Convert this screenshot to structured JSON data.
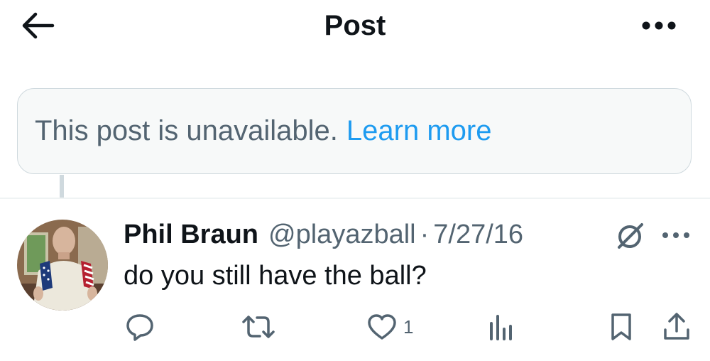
{
  "header": {
    "title": "Post",
    "back_icon": "arrow-left-icon",
    "more_icon": "more-horizontal-icon"
  },
  "notice": {
    "text": "This post is unavailable.",
    "link": "Learn more"
  },
  "post": {
    "author_name": "Phil Braun",
    "handle": "@playazball",
    "separator": "·",
    "date": "7/27/16",
    "text": "do you still have the ball?",
    "avatar_icon": "user-photo-avatar",
    "grok_icon": "grok-icon",
    "more_icon": "more-horizontal-icon"
  },
  "actions": {
    "reply_icon": "reply-icon",
    "repost_icon": "repost-icon",
    "like_icon": "heart-icon",
    "like_count": "1",
    "views_icon": "views-chart-icon",
    "bookmark_icon": "bookmark-icon",
    "share_icon": "share-icon"
  },
  "colors": {
    "accent": "#1d9bf0",
    "secondary_text": "#536471",
    "border": "#cfd9de",
    "notice_bg": "#f7f9f9"
  }
}
